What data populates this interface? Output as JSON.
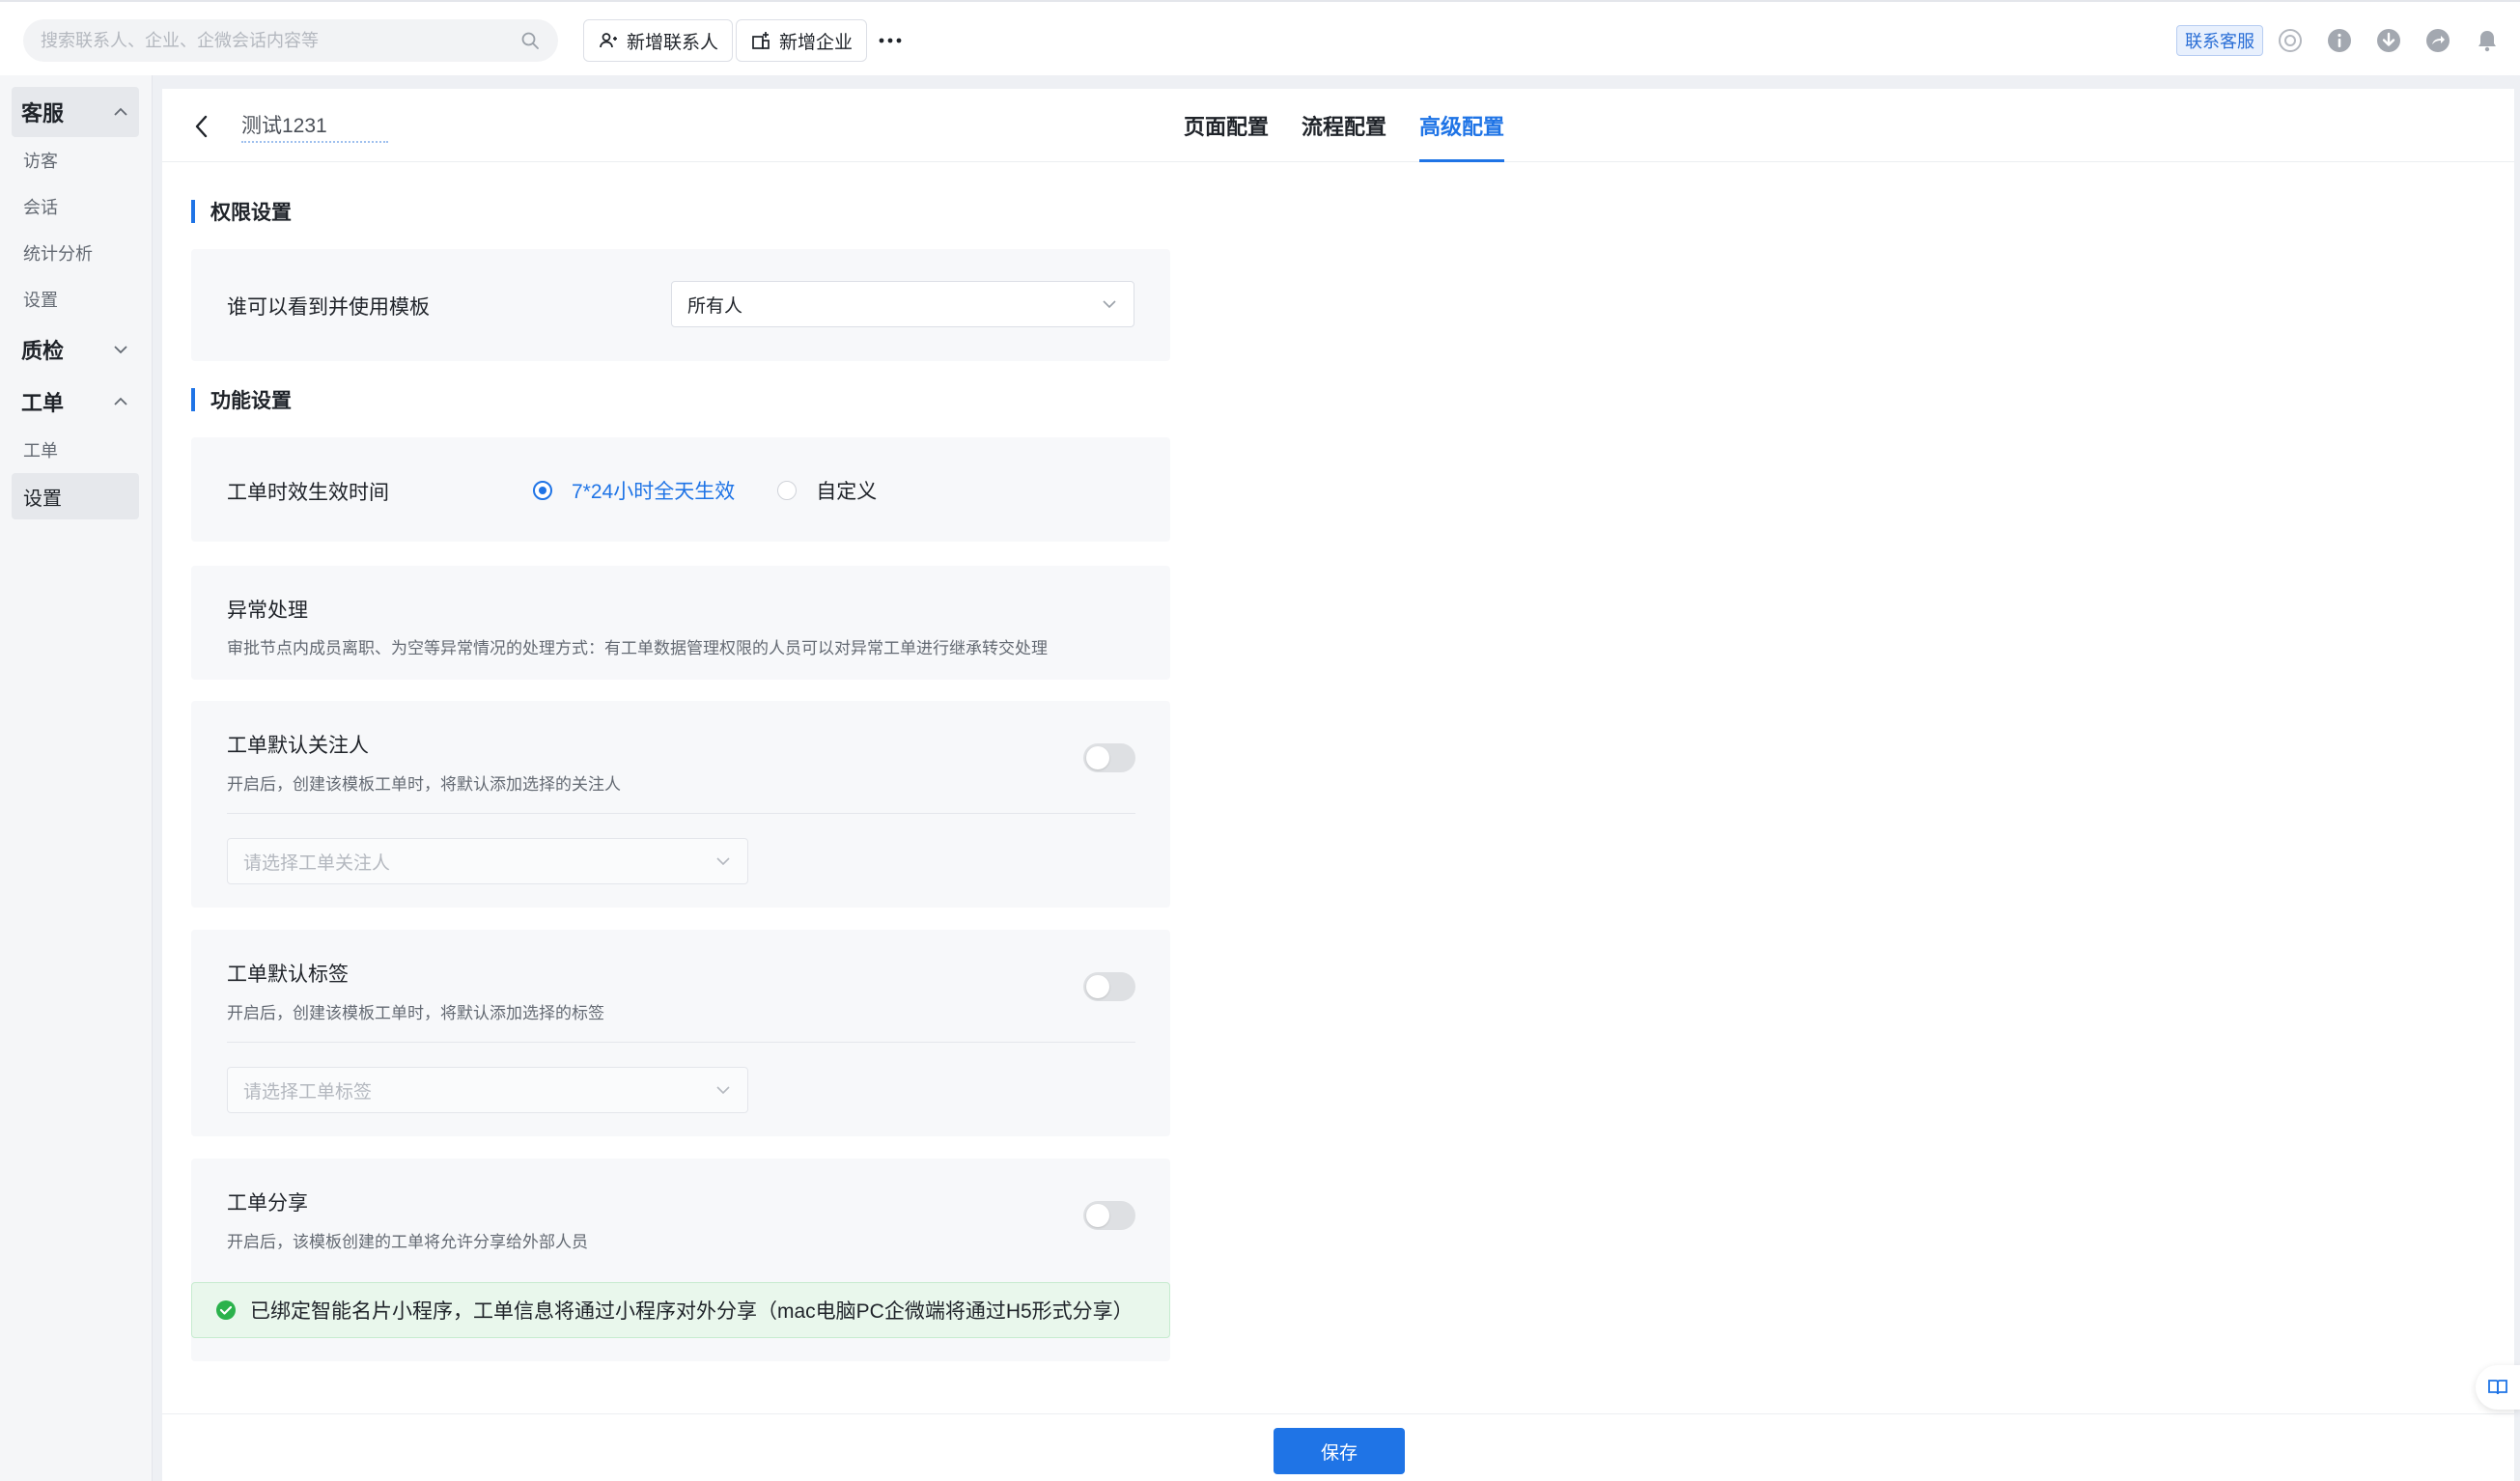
{
  "topbar": {
    "search_placeholder": "搜索联系人、企业、企微会话内容等",
    "add_contact_label": "新增联系人",
    "add_company_label": "新增企业",
    "more_label": "···",
    "service_badge": "联系客服",
    "icons": [
      "headset-icon",
      "info-icon",
      "download-icon",
      "share-icon",
      "bell-icon"
    ]
  },
  "sidebar": {
    "groups": [
      {
        "label": "客服",
        "expanded": true,
        "items": [
          "访客",
          "会话",
          "统计分析",
          "设置"
        ]
      },
      {
        "label": "质检",
        "expanded": false,
        "items": []
      },
      {
        "label": "工单",
        "expanded": true,
        "items": [
          "工单",
          "设置"
        ]
      }
    ],
    "selected_item": "设置"
  },
  "header": {
    "title": "测试1231",
    "tabs": [
      "页面配置",
      "流程配置",
      "高级配置"
    ],
    "active_tab": "高级配置"
  },
  "permission": {
    "section_title": "权限设置",
    "visibility_label": "谁可以看到并使用模板",
    "visibility_value": "所有人"
  },
  "features": {
    "section_title": "功能设置",
    "effective_time": {
      "label": "工单时效生效时间",
      "options": [
        "7*24小时全天生效",
        "自定义"
      ],
      "selected": "7*24小时全天生效"
    },
    "exception": {
      "label": "异常处理",
      "desc": "审批节点内成员离职、为空等异常情况的处理方式：有工单数据管理权限的人员可以对异常工单进行继承转交处理"
    },
    "default_follower": {
      "label": "工单默认关注人",
      "desc": "开启后，创建该模板工单时，将默认添加选择的关注人",
      "enabled": false,
      "select_placeholder": "请选择工单关注人"
    },
    "default_tag": {
      "label": "工单默认标签",
      "desc": "开启后，创建该模板工单时，将默认添加选择的标签",
      "enabled": false,
      "select_placeholder": "请选择工单标签"
    },
    "share": {
      "label": "工单分享",
      "desc": "开启后，该模板创建的工单将允许分享给外部人员",
      "enabled": false
    },
    "success_notice": "已绑定智能名片小程序，工单信息将通过小程序对外分享（mac电脑PC企微端将通过H5形式分享）"
  },
  "footer": {
    "save_label": "保存"
  },
  "colors": {
    "accent": "#1f74e6",
    "success": "#2bb24c"
  }
}
